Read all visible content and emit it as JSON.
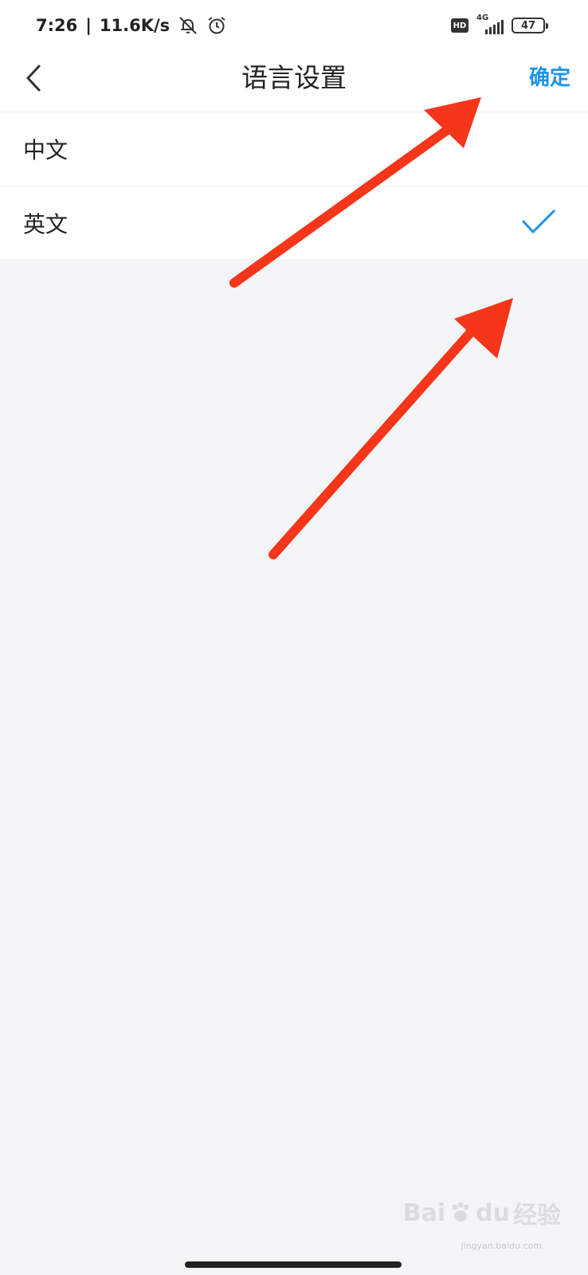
{
  "status_bar": {
    "time": "7:26",
    "separator": "|",
    "net_speed": "11.6K/s",
    "hd_badge": "HD",
    "network_type": "4G",
    "battery": "47",
    "icons": [
      "bell-off-icon",
      "alarm-clock-icon",
      "signal-icon",
      "battery-icon"
    ]
  },
  "nav": {
    "title": "语言设置",
    "confirm_label": "确定",
    "back_icon": "chevron-left-icon"
  },
  "languages": {
    "items": [
      {
        "label": "中文",
        "selected": false
      },
      {
        "label": "英文",
        "selected": true
      }
    ]
  },
  "watermark": {
    "text": "Bai",
    "text2": "du",
    "text3": "经验",
    "sub": "jingyan.baidu.com"
  },
  "colors": {
    "accent": "#1a94e6",
    "annotation_arrow": "#f5361a",
    "background": "#f4f5f7"
  }
}
